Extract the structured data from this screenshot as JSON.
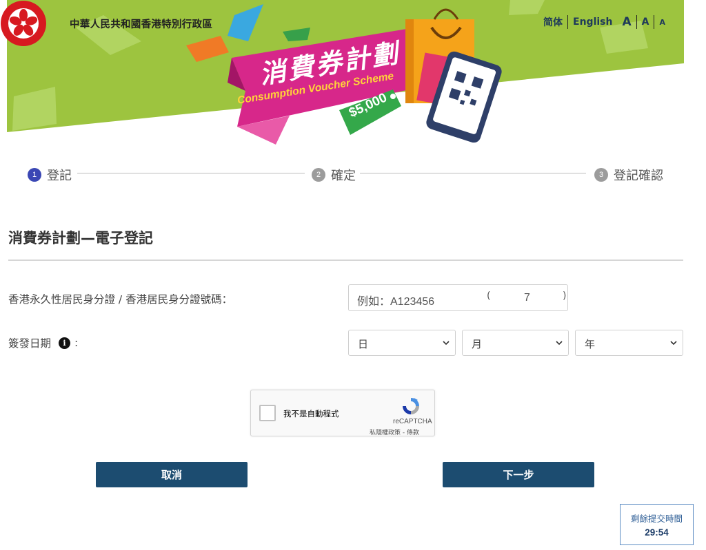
{
  "header": {
    "government_name": "中華人民共和國香港特別行政區",
    "language_options": [
      "简体",
      "English"
    ],
    "font_size_options": [
      "A",
      "A",
      "A"
    ],
    "banner_title_zh": "消費券計劃",
    "banner_title_en": "Consumption Voucher Scheme",
    "banner_amount": "$5,000",
    "colors": {
      "banner_green": "#9dc43f",
      "ribbon_pink": "#d7278a",
      "tag_green": "#34a84a"
    }
  },
  "steps": [
    {
      "number": "1",
      "label": "登記",
      "active": true
    },
    {
      "number": "2",
      "label": "確定",
      "active": false
    },
    {
      "number": "3",
      "label": "登記確認",
      "active": false
    }
  ],
  "form": {
    "title": "消費券計劃—電子登記",
    "id_label": "香港永久性居民身分證 / 香港居民身分證號碼：",
    "id_placeholder": "例如：A123456",
    "id_check_open": "(",
    "id_check_placeholder": "7",
    "id_check_close": ")",
    "issue_date_label": "簽發日期",
    "issue_date_colon": ":",
    "info_icon": "i",
    "day_select": "日",
    "month_select": "月",
    "year_select": "年"
  },
  "captcha": {
    "checkbox_label": "我不是自動程式",
    "brand": "reCAPTCHA",
    "links": "私隱權政策 - 條款"
  },
  "buttons": {
    "cancel": "取消",
    "next": "下一步",
    "color": "#1c4c70"
  },
  "timer": {
    "label": "剩餘提交時間",
    "value": "29:54"
  }
}
